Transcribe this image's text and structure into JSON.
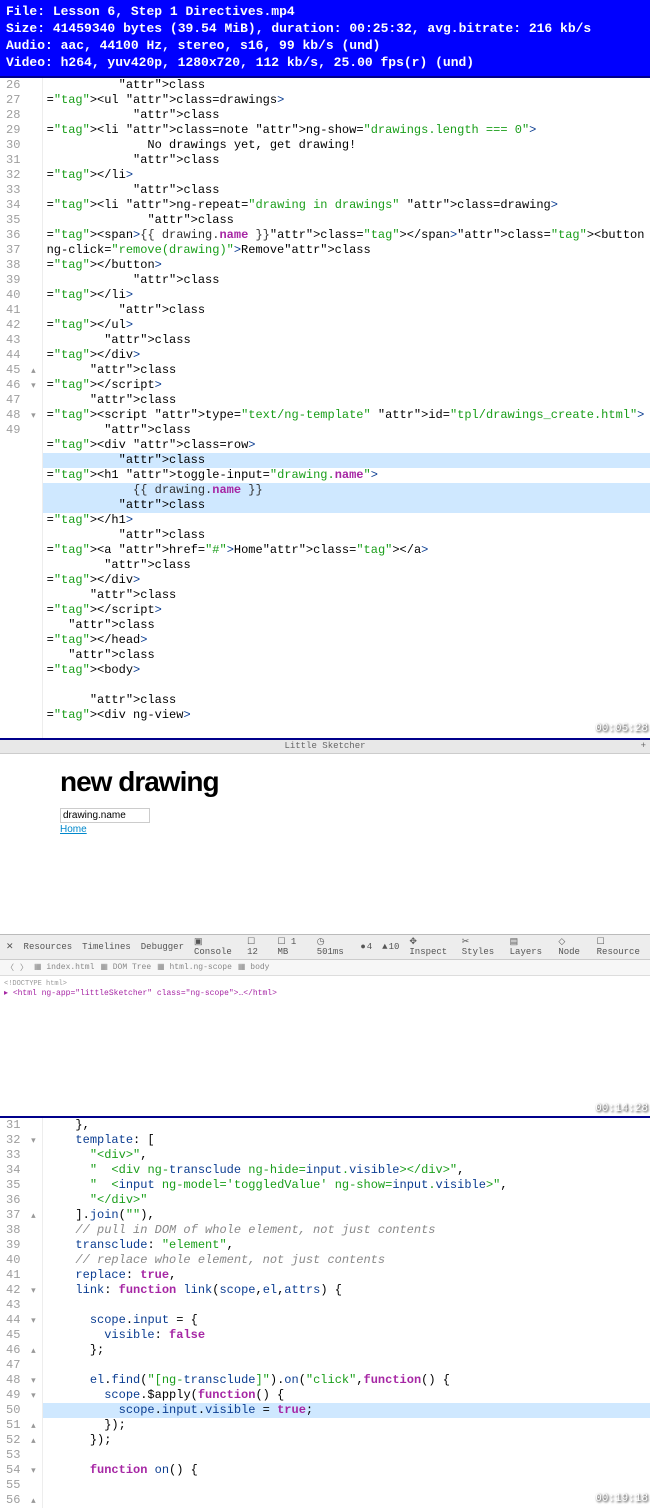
{
  "header": {
    "file_label": "File",
    "file": "Lesson 6, Step 1 Directives.mp4",
    "size_label": "Size",
    "size_bytes": "41459340",
    "size_unit": "bytes",
    "size_mib": "(39.54 MiB),",
    "duration_label": "duration",
    "duration": "00:25:32,",
    "avgbr_label": "avg.bitrate",
    "avgbr": "216 kb/s",
    "audio_label": "Audio",
    "audio": "aac, 44100 Hz, stereo, s16, 99 kb/s (und)",
    "video_label": "Video",
    "video": "h264, yuv420p, 1280x720, 112 kb/s, 25.00 fps(r) (und)"
  },
  "ed1": {
    "start": 26,
    "lines": {
      "26": "          <ul class=drawings>",
      "27": "            <li class=note ng-show=\"drawings.length === 0\">",
      "28": "              No drawings yet, get drawing!",
      "29": "            </li>",
      "30": "            <li ng-repeat=\"drawing in drawings\" class=drawing>",
      "31": "              <span>{{ drawing.name }}</span><button",
      "32": "ng-click=\"remove(drawing)\">Remove</button>",
      "33": "            </li>",
      "34": "          </ul>",
      "35": "        </div>",
      "36": "      </script_>",
      "37": "      <script_ type=\"text/ng-template\" id=\"tpl/drawings_create.html\">",
      "38": "        <div class=row>",
      "39": "          <h1 toggle-input=\"drawing.name\">",
      "40": "            {{ drawing.name }}",
      "41": "          </h1>",
      "42": "          <a href=\"#\">Home</a>",
      "43": "        </div>",
      "44": "      </script_>",
      "45": "   </head>",
      "46": "   <body>",
      "47": "",
      "48": "      <div ng-view>",
      "49": ""
    },
    "ts": "00:05:28"
  },
  "browser": {
    "title": "Little Sketcher",
    "heading": "new drawing",
    "input": "drawing.name",
    "link": "Home"
  },
  "devtools": {
    "tabs": [
      "Resources",
      "Timelines",
      "Debugger",
      "Console"
    ],
    "meta": {
      "req": "12",
      "size": "1 MB",
      "time": "501ms",
      "err": "4",
      "warn": "10",
      "inspect": "Inspect"
    },
    "right": [
      "Styles",
      "Layers",
      "Node",
      "Resource"
    ],
    "bc": [
      "index.html",
      "DOM Tree",
      "html.ng-scope",
      "body"
    ],
    "dom": "<html ng-app=\"littleSketcher\" class=\"ng-scope\">…</html>",
    "ts": "00:14:28"
  },
  "ed2": {
    "start": 31,
    "lines": {
      "31": "    },",
      "32": "    template: [",
      "33": "      \"<div>\",",
      "34": "      \"  <div ng-transclude ng-hide=input.visible></div>\",",
      "35": "      \"  <input ng-model='toggledValue' ng-show=input.visible>\",",
      "36": "      \"</div>\"",
      "37": "    ].join(\"\"),",
      "38": "    // pull in DOM of whole element, not just contents",
      "39": "    transclude: \"element\",",
      "40": "    // replace whole element, not just contents",
      "41": "    replace: true,",
      "42": "    link: function link(scope,el,attrs) {",
      "43": "",
      "44": "      scope.input = {",
      "45": "        visible: false",
      "46": "      };",
      "47": "",
      "48": "      el.find(\"[ng-transclude]\").on(\"click\",function() {",
      "49": "        scope.$apply(function() {",
      "50": "          scope.input.visible = true;",
      "51": "        });",
      "52": "      });",
      "53": "",
      "54": "      function on() {",
      "55": "",
      "56": ""
    },
    "ts": "00:19:18"
  }
}
